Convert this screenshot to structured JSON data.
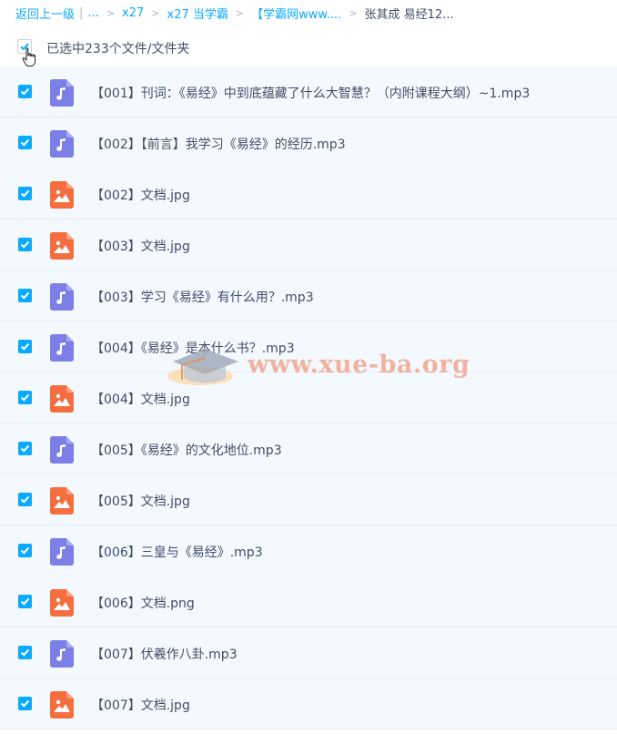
{
  "breadcrumb": {
    "back": "返回上一级",
    "ellipsis": "...",
    "items": [
      "x27",
      "x27 当学霸",
      "【学霸网www...."
    ],
    "current": "张其成 易经12..."
  },
  "selection": {
    "text": "已选中233个文件/文件夹"
  },
  "watermark": {
    "text": "www.xue-ba.org"
  },
  "colors": {
    "accent": "#09aaff",
    "audio_icon": "#7b7fe6",
    "image_icon": "#f56e3f",
    "row_bg": "#f4f9ff"
  },
  "files": [
    {
      "name": "【001】刊词：《易经》中到底蕴藏了什么大智慧？（内附课程大纲）~1.mp3",
      "icon": "music-file-icon"
    },
    {
      "name": "【002】【前言】我学习《易经》的经历.mp3",
      "icon": "music-file-icon"
    },
    {
      "name": "【002】文档.jpg",
      "icon": "image-file-icon"
    },
    {
      "name": "【003】文档.jpg",
      "icon": "image-file-icon"
    },
    {
      "name": "【003】学习《易经》有什么用？.mp3",
      "icon": "music-file-icon"
    },
    {
      "name": "【004】《易经》是本什么书？.mp3",
      "icon": "music-file-icon"
    },
    {
      "name": "【004】文档.jpg",
      "icon": "image-file-icon"
    },
    {
      "name": "【005】《易经》的文化地位.mp3",
      "icon": "music-file-icon"
    },
    {
      "name": "【005】文档.jpg",
      "icon": "image-file-icon"
    },
    {
      "name": "【006】三皇与《易经》.mp3",
      "icon": "music-file-icon"
    },
    {
      "name": "【006】文档.png",
      "icon": "image-file-icon"
    },
    {
      "name": "【007】伏羲作八卦.mp3",
      "icon": "music-file-icon"
    },
    {
      "name": "【007】文档.jpg",
      "icon": "image-file-icon"
    }
  ]
}
